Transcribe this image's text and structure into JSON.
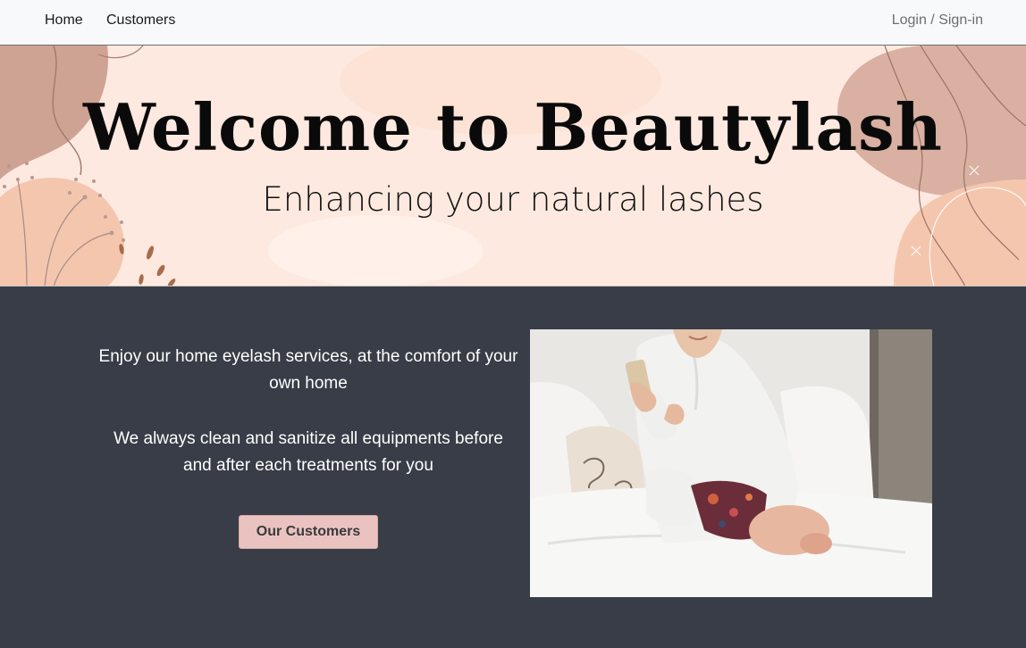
{
  "nav": {
    "home": "Home",
    "customers": "Customers",
    "login": "Login / Sign-in"
  },
  "hero": {
    "title": "Welcome to Beautylash",
    "subtitle": "Enhancing your natural lashes"
  },
  "info": {
    "paragraph1": "Enjoy our home eyelash services, at the comfort of your own home",
    "paragraph2": "We always clean and sanitize all equipments before and after each treatments for you",
    "button_label": "Our Customers"
  },
  "colors": {
    "navbar_bg": "#f8f9fa",
    "hero_bg": "#fde9df",
    "section_bg": "#383d47",
    "button_bg": "#eac3c1",
    "blob_tan": "#d4aa9a",
    "blob_peach": "#f5c6ae"
  }
}
